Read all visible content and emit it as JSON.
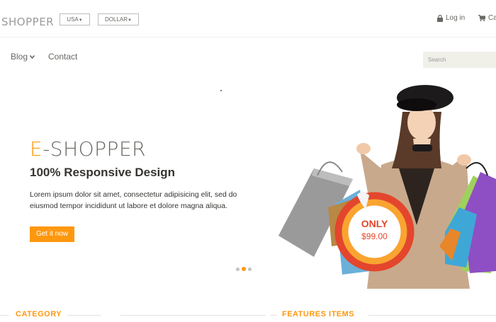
{
  "header": {
    "logo_text": "SHOPPER",
    "country": "USA",
    "currency": "DOLLAR",
    "login_label": "Log in",
    "cart_label": "Ca"
  },
  "nav": {
    "blog_label": "Blog",
    "contact_label": "Contact",
    "search_placeholder": "Search"
  },
  "hero": {
    "title_accent": "E",
    "title_rest": "-SHOPPER",
    "subtitle": "100% Responsive Design",
    "description": "Lorem ipsum dolor sit amet, consectetur adipisicing elit, sed do eiusmod tempor incididunt ut labore et dolore magna aliqua.",
    "button_label": "Get it now",
    "tag_only": "ONLY",
    "tag_price": "$99.00"
  },
  "sections": {
    "category_title": "CATEGORY",
    "features_title": "FEATURES ITEMS"
  },
  "colors": {
    "accent": "#fe980f",
    "tag_red": "#e3462c"
  }
}
